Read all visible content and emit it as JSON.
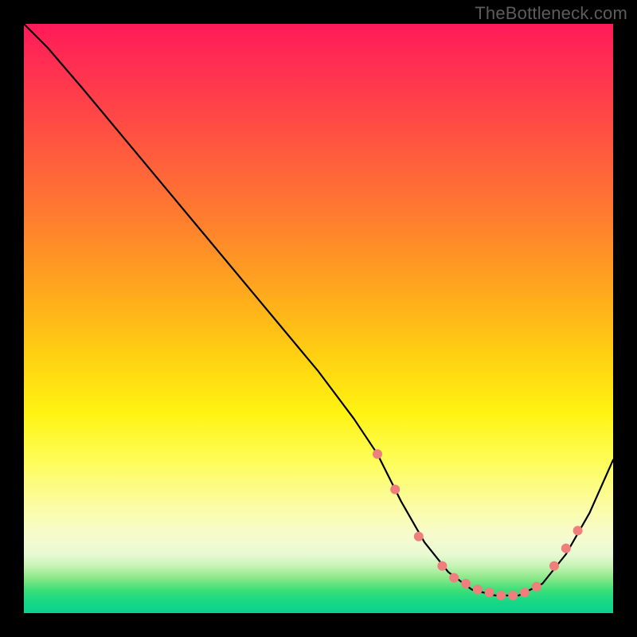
{
  "attribution": "TheBottleneck.com",
  "chart_data": {
    "type": "line",
    "title": "",
    "xlabel": "",
    "ylabel": "",
    "xlim": [
      0,
      100
    ],
    "ylim": [
      0,
      100
    ],
    "background": "rainbow-vertical-gradient",
    "series": [
      {
        "name": "bottleneck-curve",
        "x": [
          0,
          4,
          10,
          20,
          30,
          40,
          50,
          56,
          60,
          64,
          68,
          72,
          76,
          80,
          84,
          88,
          92,
          96,
          100
        ],
        "y": [
          100,
          96,
          89,
          77,
          65,
          53,
          41,
          33,
          27,
          19,
          12,
          7,
          4,
          3,
          3,
          5,
          10,
          17,
          26
        ]
      }
    ],
    "markers": {
      "name": "highlight-dots",
      "color": "#ef7f7c",
      "points": [
        {
          "x": 60,
          "y": 27
        },
        {
          "x": 63,
          "y": 21
        },
        {
          "x": 67,
          "y": 13
        },
        {
          "x": 71,
          "y": 8
        },
        {
          "x": 73,
          "y": 6
        },
        {
          "x": 75,
          "y": 5
        },
        {
          "x": 77,
          "y": 4
        },
        {
          "x": 79,
          "y": 3.5
        },
        {
          "x": 81,
          "y": 3
        },
        {
          "x": 83,
          "y": 3
        },
        {
          "x": 85,
          "y": 3.5
        },
        {
          "x": 87,
          "y": 4.5
        },
        {
          "x": 90,
          "y": 8
        },
        {
          "x": 92,
          "y": 11
        },
        {
          "x": 94,
          "y": 14
        }
      ]
    }
  }
}
